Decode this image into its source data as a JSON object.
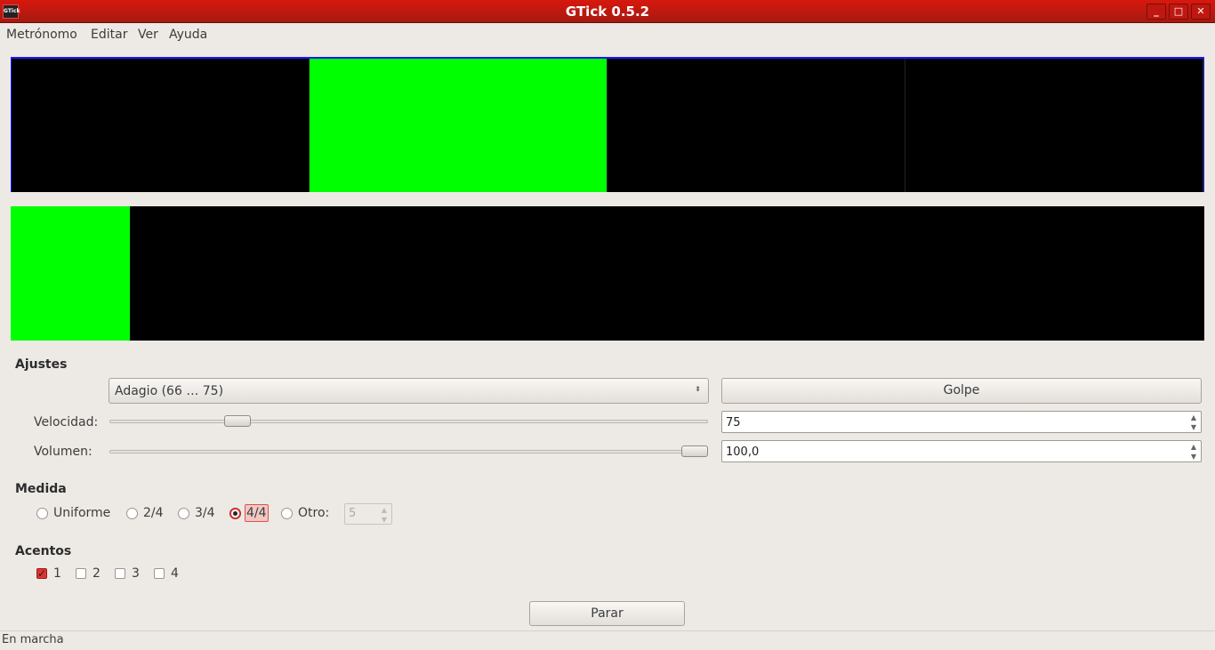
{
  "window": {
    "title": "GTick 0.5.2",
    "icon_text": "GTick"
  },
  "menu": [
    "Metrónomo",
    "Editar",
    "Ver",
    "Ayuda"
  ],
  "beats": {
    "count": 4,
    "active": 2,
    "active_color": "#00ff00"
  },
  "progress": {
    "fraction": 0.1
  },
  "settings": {
    "header": "Ajustes",
    "tempo_preset": "Adagio  (66 … 75)",
    "beat_button": "Golpe",
    "speed_label": "Velocidad:",
    "speed_value": "75",
    "speed_fraction": 0.2,
    "volume_label": "Volumen:",
    "volume_value": "100,0",
    "volume_fraction": 1.0
  },
  "measure": {
    "header": "Medida",
    "options": [
      "Uniforme",
      "2/4",
      "3/4",
      "4/4",
      "Otro:"
    ],
    "selected": "4/4",
    "other_value": "5"
  },
  "accents": {
    "header": "Acentos",
    "items": [
      "1",
      "2",
      "3",
      "4"
    ],
    "checked": [
      "1"
    ]
  },
  "stop_button": "Parar",
  "status": "En marcha"
}
